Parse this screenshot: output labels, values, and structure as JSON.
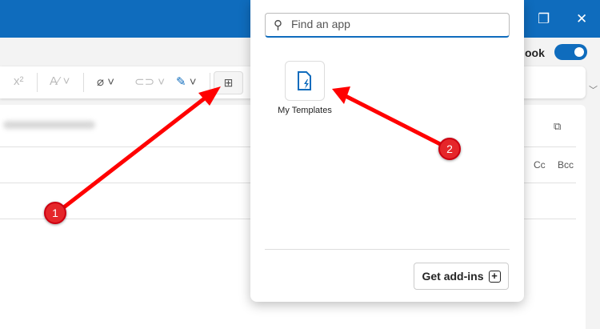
{
  "window": {
    "restore_icon": "restore-icon",
    "close_icon": "close-icon"
  },
  "header": {
    "toggle_label_partial": "ook",
    "toggle_on": true
  },
  "ribbon": {
    "superscript": "x²",
    "apps_icon": "apps-grid-icon"
  },
  "compose": {
    "cc": "Cc",
    "bcc": "Bcc"
  },
  "popup": {
    "search_placeholder": "Find an app",
    "apps": [
      {
        "label": "My Templates",
        "icon": "templates-icon"
      }
    ],
    "get_addins_label": "Get add-ins"
  },
  "annotations": [
    {
      "label": "1"
    },
    {
      "label": "2"
    }
  ],
  "colors": {
    "accent": "#0f6cbd",
    "annotation": "#e5262a"
  }
}
